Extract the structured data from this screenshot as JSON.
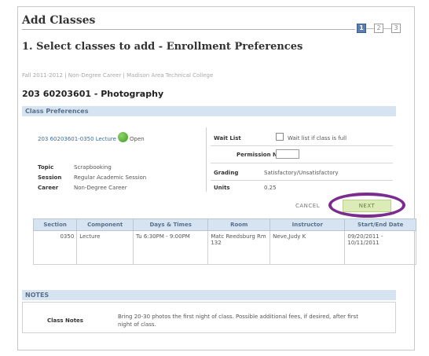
{
  "page": {
    "title": "Add Classes"
  },
  "steps": [
    "1",
    "2",
    "3"
  ],
  "heading": "1.  Select classes to add - Enrollment Preferences",
  "term_line": "Fall 2011-2012 | Non-Degree Career | Madison Area Technical College",
  "course_title": "203 60203601 - Photography",
  "preferences": {
    "header": "Class Preferences",
    "class_link": "203 60203601-0350  Lecture",
    "status": "Open",
    "topic_label": "Topic",
    "topic_value": "Scrapbooking",
    "session_label": "Session",
    "session_value": "Regular Academic Session",
    "career_label": "Career",
    "career_value": "Non-Degree Career",
    "wait_list_label": "Wait List",
    "wait_list_checkbox_label": "Wait list if class is full",
    "permission_label": "Permission Nbr",
    "grading_label": "Grading",
    "grading_value": "Satisfactory/Unsatisfactory",
    "units_label": "Units",
    "units_value": "0.25"
  },
  "buttons": {
    "cancel": "CANCEL",
    "next": "NEXT"
  },
  "table": {
    "headers": [
      "Section",
      "Component",
      "Days & Times",
      "Room",
      "Instructor",
      "Start/End Date"
    ],
    "row": {
      "section": "0350",
      "component": "Lecture",
      "days_times": "Tu 6:30PM - 9:00PM",
      "room": "Matc Reedsburg Rm 132",
      "instructor": "Neve,Judy K",
      "dates": "09/20/2011 - 10/11/2011"
    }
  },
  "notes": {
    "header": "NOTES",
    "label": "Class Notes",
    "text": "Bring 20-30 photos the first night of class.   Possible additional fees, if desired, after first night of class."
  },
  "colors": {
    "section_header_bg": "#d6e3f0",
    "link": "#3d6c9c",
    "open_status": "#3f9a24",
    "next_button_bg": "#dcecb8",
    "annotation_oval": "#7b2d8e",
    "active_step": "#5b7fb0"
  }
}
